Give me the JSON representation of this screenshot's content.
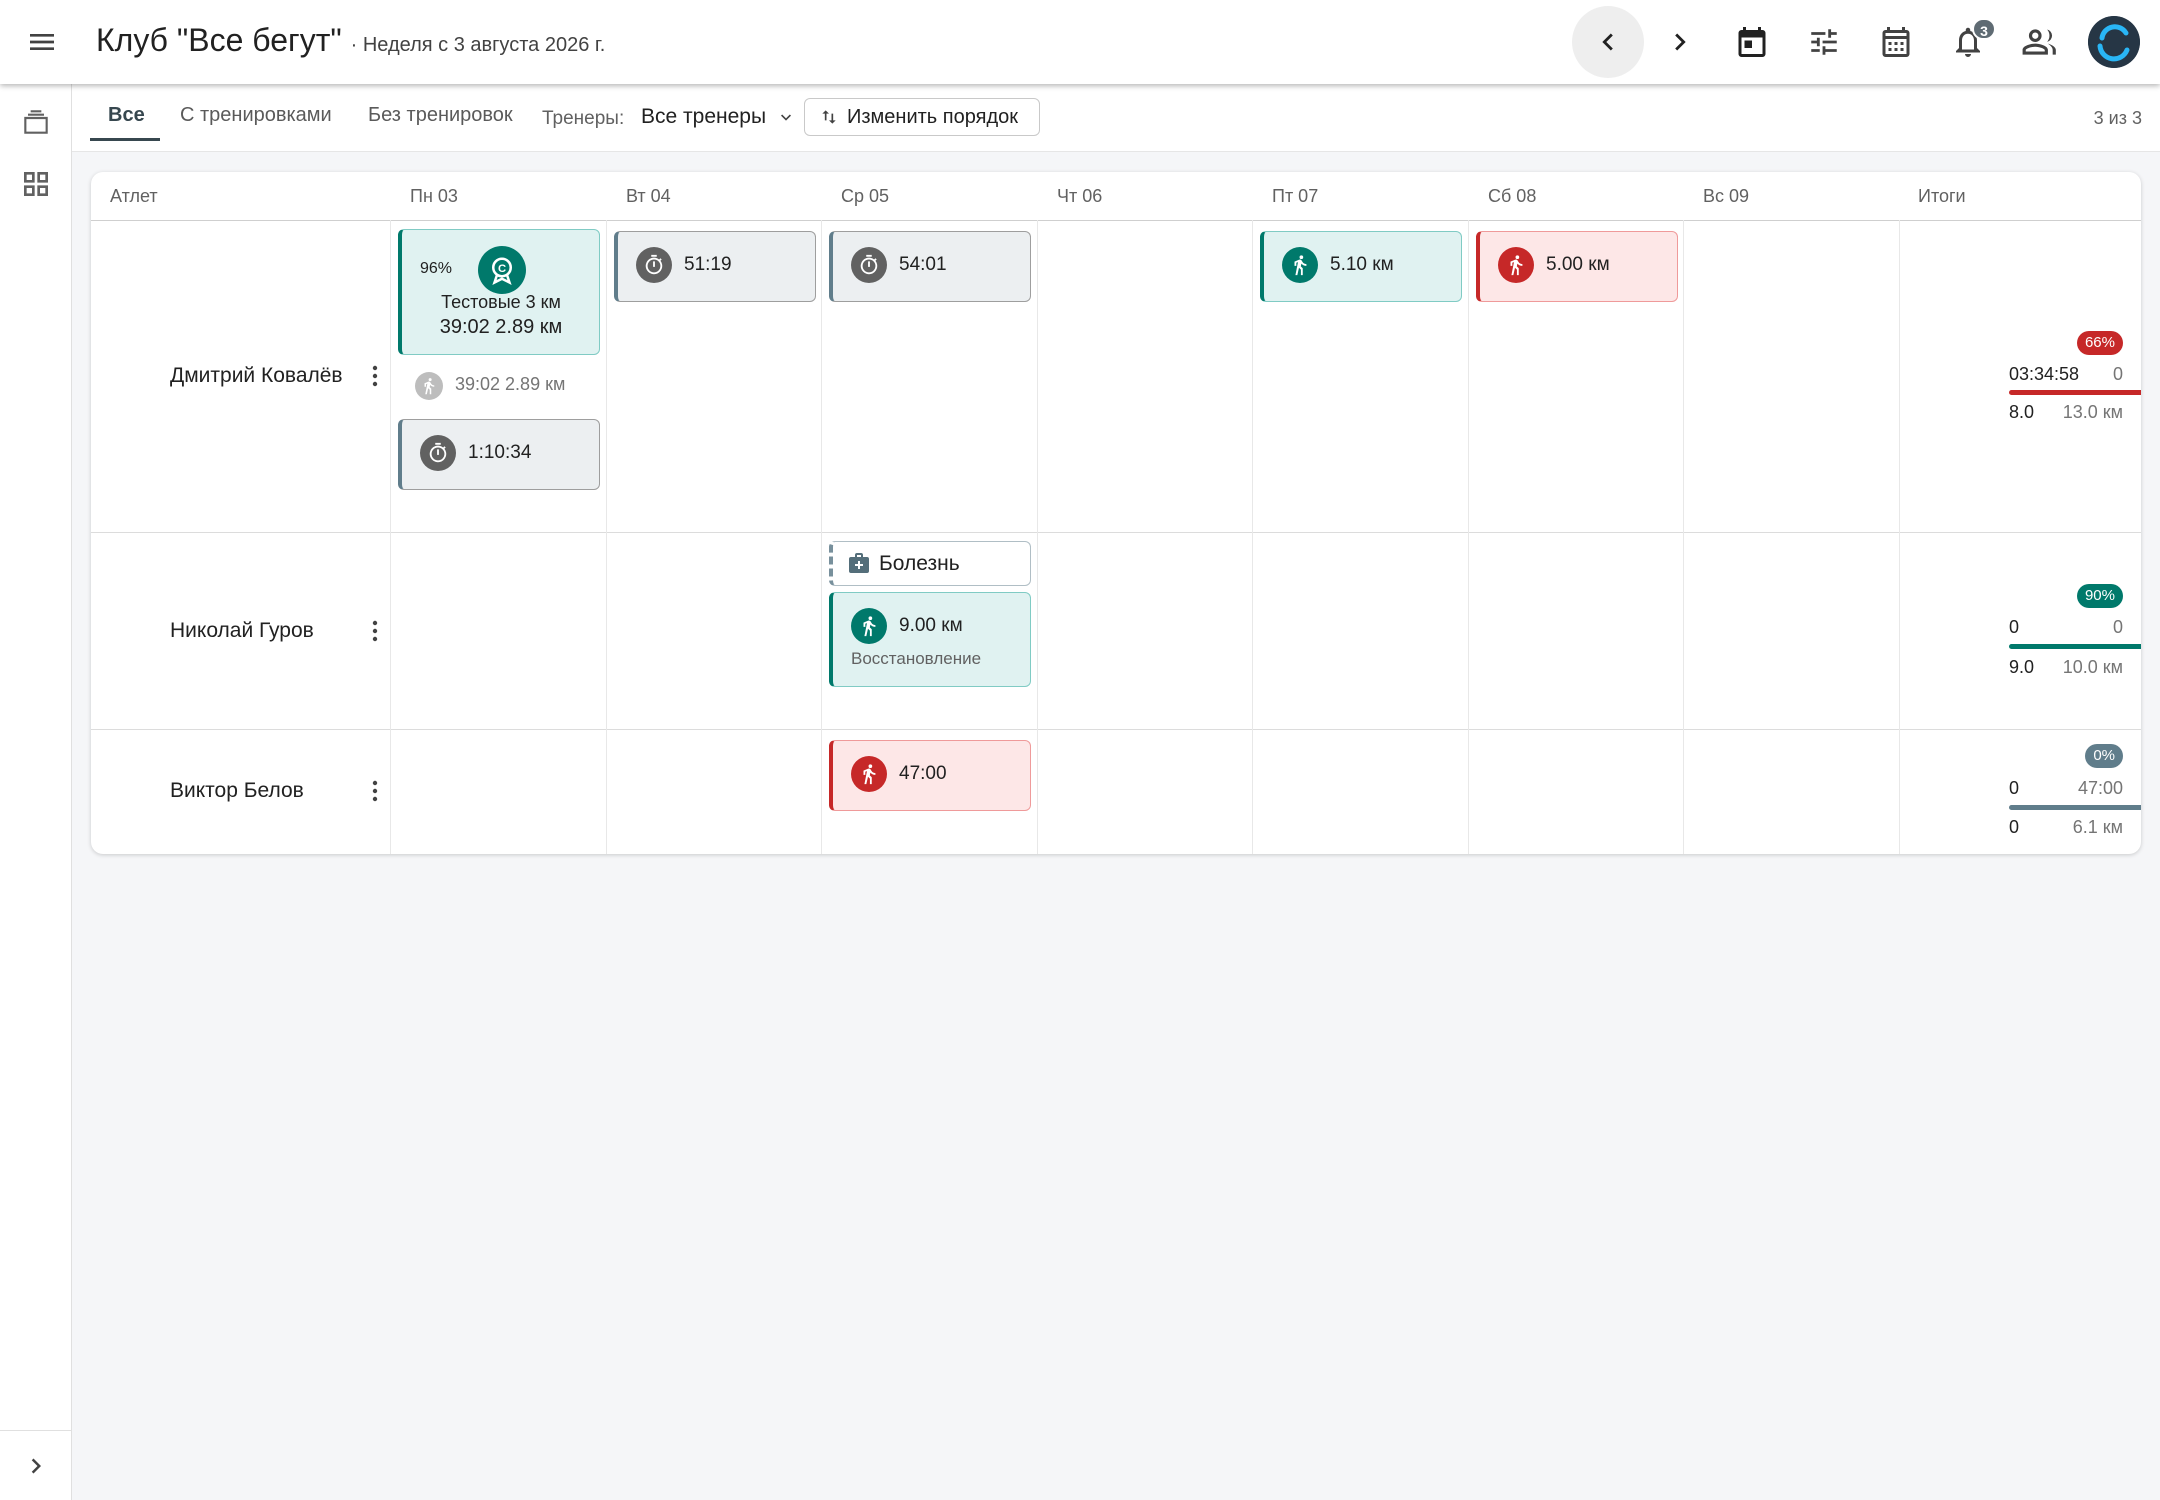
{
  "header": {
    "title": "Клуб \"Все бегут\"",
    "subtitle": "· Неделя с 3 августа 2026 г.",
    "notification_count": "3",
    "icons": [
      "menu-icon",
      "chevron-left-icon",
      "chevron-right-icon",
      "today-calendar-icon",
      "filters-icon",
      "calendar-icon",
      "bell-icon",
      "people-icon",
      "avatar"
    ]
  },
  "sidebar": {
    "icons": [
      "layers-icon",
      "grid-icon",
      "chevron-right-icon"
    ]
  },
  "filters": {
    "tabs": [
      "Все",
      "С тренировками",
      "Без тренировок"
    ],
    "coach_label": "Тренеры:",
    "coach_value": "Все тренеры",
    "reorder_label": "Изменить порядок",
    "count": "3 из 3"
  },
  "table": {
    "headers": [
      "Атлет",
      "Пн 03",
      "Вт 04",
      "Ср 05",
      "Чт 06",
      "Пт 07",
      "Сб 08",
      "Вс 09",
      "Итоги"
    ]
  },
  "athletes": [
    {
      "name": "Дмитрий Ковалёв",
      "cards": {
        "test_pct": "96%",
        "test_name": "Тестовые 3 км",
        "test_result": "39:02 2.89 км",
        "mon_activity": "39:02 2.89 км",
        "mon_timer": "1:10:34",
        "tue_timer": "51:19",
        "wed_timer": "54:01",
        "fri_run": "5.10 км",
        "sat_run": "5.00 км"
      },
      "totals": {
        "pct": "66%",
        "time_done": "03:34:58",
        "time_plan": "0",
        "dist_done": "8.0",
        "dist_plan": "13.0 км",
        "color": "#c62828"
      }
    },
    {
      "name": "Николай Гуров",
      "cards": {
        "illness": "Болезнь",
        "run": "9.00 км",
        "run_note": "Восстановление"
      },
      "totals": {
        "pct": "90%",
        "time_done": "0",
        "time_plan": "0",
        "dist_done": "9.0",
        "dist_plan": "10.0 км",
        "color": "#00796b"
      }
    },
    {
      "name": "Виктор Белов",
      "cards": {
        "run": "47:00"
      },
      "totals": {
        "pct": "0%",
        "time_done": "0",
        "time_plan": "47:00",
        "dist_done": "0",
        "dist_plan": "6.1 км",
        "color": "#607d8b"
      }
    }
  ],
  "colors": {
    "green": "#00796b",
    "red": "#c62828",
    "grey": "#607d8b"
  }
}
